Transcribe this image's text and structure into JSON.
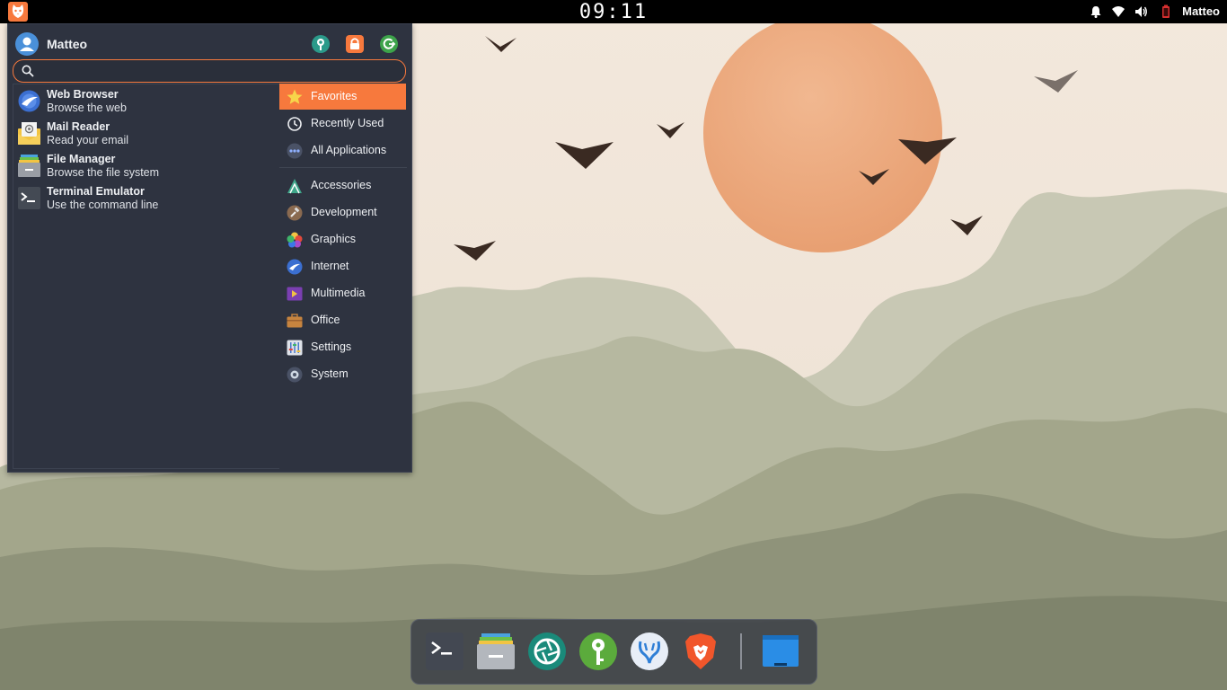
{
  "top_panel": {
    "clock": "09:11",
    "tray": {
      "notifications_icon": "bell-icon",
      "network_icon": "wifi-icon",
      "volume_icon": "speaker-icon",
      "battery_icon": "battery-icon",
      "user": "Matteo"
    },
    "menu_icon": "cat-logo-icon"
  },
  "menu": {
    "user_name": "Matteo",
    "actions": [
      {
        "icon": "settings-manager-icon",
        "color": "#2b9a8a"
      },
      {
        "icon": "lock-icon",
        "color": "#f7793d"
      },
      {
        "icon": "logout-icon",
        "color": "#3da34a"
      }
    ],
    "search": {
      "value": "",
      "placeholder": ""
    },
    "apps": [
      {
        "name": "Web Browser",
        "description": "Browse the web",
        "icon": "web-browser-icon"
      },
      {
        "name": "Mail Reader",
        "description": "Read your email",
        "icon": "mail-reader-icon"
      },
      {
        "name": "File Manager",
        "description": "Browse the file system",
        "icon": "file-manager-icon"
      },
      {
        "name": "Terminal Emulator",
        "description": "Use the command line",
        "icon": "terminal-icon"
      }
    ],
    "categories_top": [
      {
        "label": "Favorites",
        "icon": "star-icon",
        "active": true
      },
      {
        "label": "Recently Used",
        "icon": "clock-icon",
        "active": false
      },
      {
        "label": "All Applications",
        "icon": "dots-icon",
        "active": false
      }
    ],
    "categories": [
      {
        "label": "Accessories",
        "icon": "accessories-icon"
      },
      {
        "label": "Development",
        "icon": "hammer-icon"
      },
      {
        "label": "Graphics",
        "icon": "graphics-icon"
      },
      {
        "label": "Internet",
        "icon": "internet-icon"
      },
      {
        "label": "Multimedia",
        "icon": "multimedia-icon"
      },
      {
        "label": "Office",
        "icon": "briefcase-icon"
      },
      {
        "label": "Settings",
        "icon": "settings-icon"
      },
      {
        "label": "System",
        "icon": "gear-icon"
      }
    ]
  },
  "dock": {
    "items": [
      {
        "icon": "terminal-icon"
      },
      {
        "icon": "file-manager-icon"
      },
      {
        "icon": "aperture-icon"
      },
      {
        "icon": "keyring-icon"
      },
      {
        "icon": "vscodium-icon"
      },
      {
        "icon": "brave-icon"
      },
      {
        "icon": "show-desktop-icon"
      }
    ]
  },
  "colors": {
    "accent": "#f7793d",
    "menu_bg": "#2e3340",
    "panel_bg": "#000000"
  }
}
